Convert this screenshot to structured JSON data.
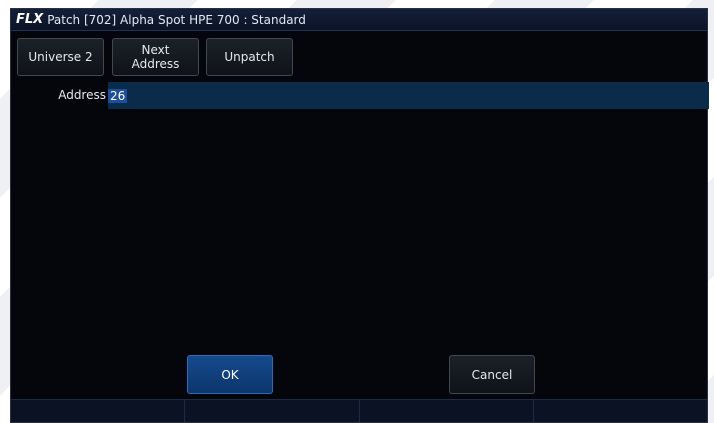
{
  "titlebar": {
    "logo": "FLX",
    "title": "Patch [702] Alpha Spot HPE 700 : Standard"
  },
  "toolbar": {
    "universe_label": "Universe 2",
    "next_line1": "Next",
    "next_line2": "Address",
    "unpatch_label": "Unpatch"
  },
  "address": {
    "label": "Address",
    "value": "26"
  },
  "actions": {
    "ok_label": "OK",
    "cancel_label": "Cancel"
  },
  "colors": {
    "background": "#05060b",
    "accent": "#154a8f",
    "field": "#0b2b4a"
  }
}
